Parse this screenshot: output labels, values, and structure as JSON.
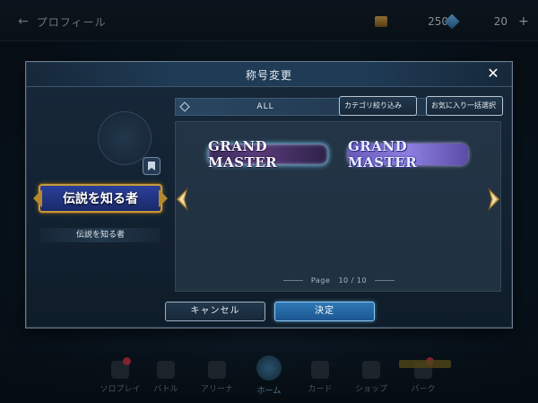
{
  "topbar": {
    "back_label": "プロフィール",
    "currencies": [
      {
        "icon": "coin-icon",
        "value": "250"
      },
      {
        "icon": "gem-icon",
        "value": "20"
      }
    ],
    "plus": "+"
  },
  "bottom_nav": {
    "items": [
      {
        "label": "ソロプレイ",
        "icon": "solo-play-icon",
        "badge": "!"
      },
      {
        "label": "バトル",
        "icon": "battle-icon"
      },
      {
        "label": "アリーナ",
        "icon": "arena-icon"
      },
      {
        "label": "ホーム",
        "icon": "home-icon",
        "active": true
      },
      {
        "label": "カード",
        "icon": "cards-icon"
      },
      {
        "label": "ショップ",
        "icon": "shop-icon"
      },
      {
        "label": "パーク",
        "icon": "park-icon",
        "badge": "!"
      }
    ]
  },
  "modal": {
    "title": "称号変更",
    "close": "✕",
    "current_title_badge": "伝説を知る者",
    "current_title_name": "伝説を知る者",
    "filter": {
      "label": "ALL",
      "category_button": "カテゴリ絞り込み",
      "favorite_button": "お気に入り一括選択"
    },
    "titles": [
      {
        "text": "GRAND MASTER",
        "style": "dark-purple"
      },
      {
        "text": "GRAND MASTER",
        "style": "lavender"
      }
    ],
    "page": {
      "label": "Page",
      "value": "10 / 10"
    },
    "cancel_button": "キャンセル",
    "confirm_button": "決定"
  },
  "colors": {
    "accent_blue": "#2f78b6",
    "badge_gold": "#c59a3f",
    "badge_blue": "#2a3f9a"
  }
}
